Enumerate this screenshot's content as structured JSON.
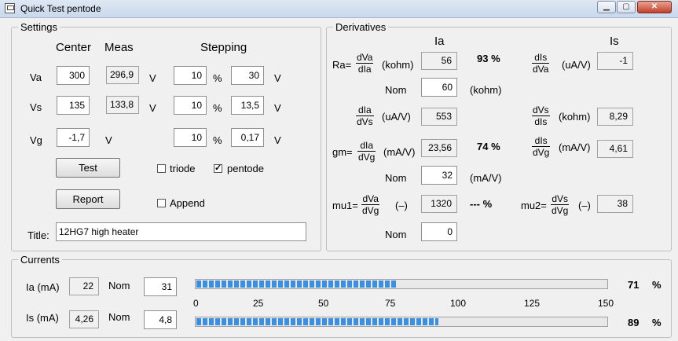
{
  "window": {
    "title": "Quick Test pentode"
  },
  "settings": {
    "legend": "Settings",
    "hdr_center": "Center",
    "hdr_meas": "Meas",
    "hdr_stepping": "Stepping",
    "va": {
      "label": "Va",
      "center": "300",
      "meas": "296,9",
      "unit": "V",
      "step_pct": "10",
      "pct": "%",
      "step_v": "30",
      "step_unit": "V"
    },
    "vs": {
      "label": "Vs",
      "center": "135",
      "meas": "133,8",
      "unit": "V",
      "step_pct": "10",
      "pct": "%",
      "step_v": "13,5",
      "step_unit": "V"
    },
    "vg": {
      "label": "Vg",
      "center": "-1,7",
      "unit": "V",
      "step_pct": "10",
      "pct": "%",
      "step_v": "0,17",
      "step_unit": "V"
    },
    "test_button": "Test",
    "report_button": "Report",
    "triode_label": "triode",
    "pentode_label": "pentode",
    "append_label": "Append",
    "title_label": "Title:",
    "title_value": "12HG7 high heater",
    "triode_checked": false,
    "pentode_checked": true,
    "append_checked": false
  },
  "derivatives": {
    "legend": "Derivatives",
    "hdr_ia": "Ia",
    "hdr_is": "Is",
    "ra_label": "Ra=",
    "ra_num": "dVa",
    "ra_den": "dIa",
    "ra_unit": "(kohm)",
    "ra_value": "56",
    "ra_pct": "93 %",
    "ra_nom_label": "Nom",
    "ra_nom_value": "60",
    "ra_nom_unit": "(kohm)",
    "dis_dva_num": "dIs",
    "dis_dva_den": "dVa",
    "dis_dva_unit": "(uA/V)",
    "dis_dva_value": "-1",
    "dia_dvs_num": "dIa",
    "dia_dvs_den": "dVs",
    "dia_dvs_unit": "(uA/V)",
    "dia_dvs_value": "553",
    "dvs_dis_num": "dVs",
    "dvs_dis_den": "dIs",
    "dvs_dis_unit": "(kohm)",
    "dvs_dis_value": "8,29",
    "gm_label": "gm=",
    "gm_num": "dIa",
    "gm_den": "dVg",
    "gm_unit": "(mA/V)",
    "gm_value": "23,56",
    "gm_pct": "74 %",
    "gm_nom_label": "Nom",
    "gm_nom_value": "32",
    "gm_nom_unit": "(mA/V)",
    "dis_dvg_num": "dIs",
    "dis_dvg_den": "dVg",
    "dis_dvg_unit": "(mA/V)",
    "dis_dvg_value": "4,61",
    "mu1_label": "mu1=",
    "mu1_num": "dVa",
    "mu1_den": "dVg",
    "mu1_unit": "(–)",
    "mu1_value": "1320",
    "mu1_pct": "--- %",
    "mu1_nom_label": "Nom",
    "mu1_nom_value": "0",
    "mu2_label": "mu2=",
    "mu2_num": "dVs",
    "mu2_den": "dVg",
    "mu2_unit": "(–)",
    "mu2_value": "38"
  },
  "currents": {
    "legend": "Currents",
    "ia_label": "Ia (mA)",
    "ia_value": "22",
    "ia_nom_label": "Nom",
    "ia_nom_value": "31",
    "ia_bar_fraction": 0.49,
    "ia_pct": "71",
    "ia_pct_sign": "%",
    "is_label": "Is (mA)",
    "is_value": "4,26",
    "is_nom_label": "Nom",
    "is_nom_value": "4,8",
    "is_bar_fraction": 0.59,
    "is_pct": "89",
    "is_pct_sign": "%",
    "scale": [
      "0",
      "25",
      "50",
      "75",
      "100",
      "125",
      "150"
    ]
  }
}
